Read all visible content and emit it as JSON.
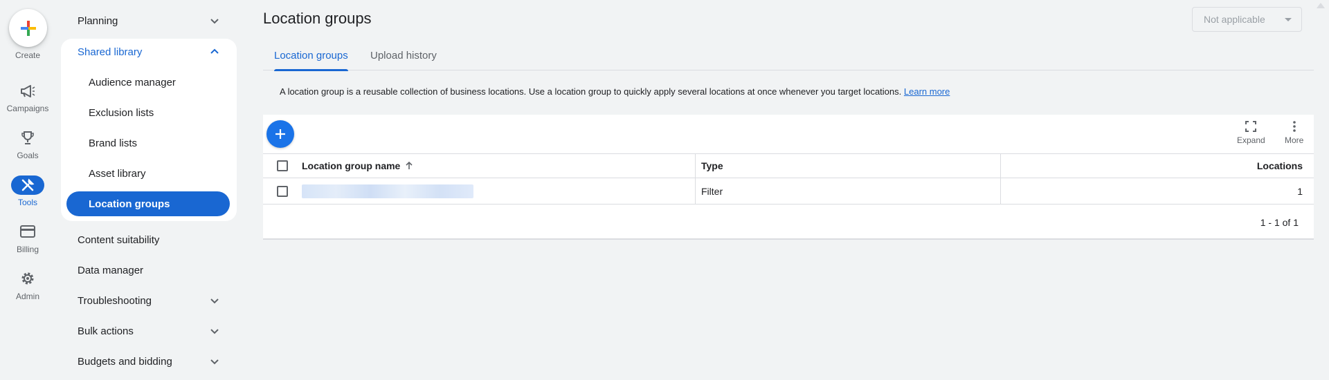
{
  "rail": {
    "create": "Create",
    "items": [
      {
        "label": "Campaigns",
        "icon": "megaphone-icon"
      },
      {
        "label": "Goals",
        "icon": "trophy-icon"
      },
      {
        "label": "Tools",
        "icon": "tools-icon"
      },
      {
        "label": "Billing",
        "icon": "credit-card-icon"
      },
      {
        "label": "Admin",
        "icon": "gear-icon"
      }
    ],
    "active": "Tools"
  },
  "nav": {
    "planning": "Planning",
    "shared_library": "Shared library",
    "shared_items": [
      "Audience manager",
      "Exclusion lists",
      "Brand lists",
      "Asset library",
      "Location groups"
    ],
    "content_suitability": "Content suitability",
    "data_manager": "Data manager",
    "troubleshooting": "Troubleshooting",
    "bulk_actions": "Bulk actions",
    "budgets_bidding": "Budgets and bidding"
  },
  "main": {
    "title": "Location groups",
    "account_select": "Not applicable",
    "tabs": [
      "Location groups",
      "Upload history"
    ],
    "info_text": "A location group is a reusable collection of business locations. Use a location group to quickly apply several locations at once whenever you target locations.",
    "learn_more": "Learn more",
    "toolbar": {
      "expand": "Expand",
      "more": "More"
    },
    "table": {
      "columns": [
        "Location group name",
        "Type",
        "Locations"
      ],
      "rows": [
        {
          "name": "",
          "type": "Filter",
          "locations": "1"
        }
      ]
    },
    "pager": "1 - 1 of 1"
  },
  "colors": {
    "accent": "#1967d2",
    "fab": "#1a73e8",
    "background": "#f1f3f4"
  }
}
